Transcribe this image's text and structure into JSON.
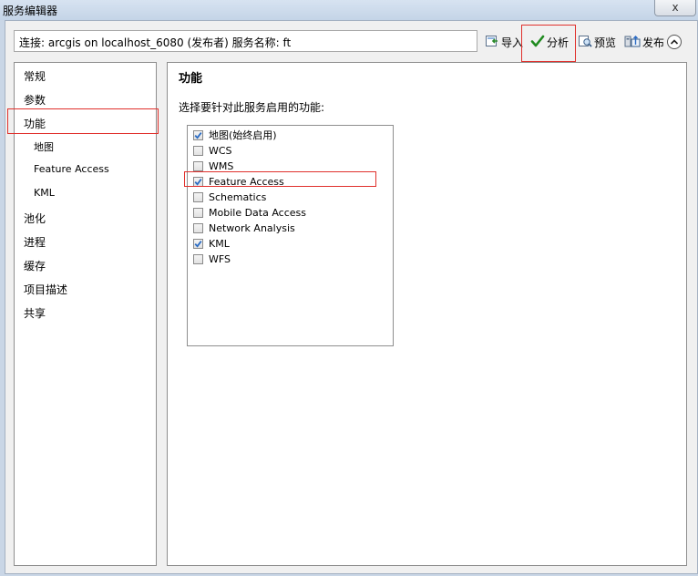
{
  "window": {
    "title": "服务编辑器",
    "close_glyph": "x"
  },
  "connection": {
    "text": "连接: arcgis on localhost_6080 (发布者)    服务名称: ft"
  },
  "toolbar": {
    "import_label": "导入",
    "analyze_label": "分析",
    "preview_label": "预览",
    "publish_label": "发布"
  },
  "sidebar": {
    "items": [
      {
        "label": "常规"
      },
      {
        "label": "参数"
      },
      {
        "label": "功能"
      },
      {
        "label": "地图"
      },
      {
        "label": "Feature Access"
      },
      {
        "label": "KML"
      },
      {
        "label": "池化"
      },
      {
        "label": "进程"
      },
      {
        "label": "缓存"
      },
      {
        "label": "项目描述"
      },
      {
        "label": "共享"
      }
    ]
  },
  "main": {
    "title": "功能",
    "description": "选择要针对此服务启用的功能:",
    "capabilities": [
      {
        "label": "地图(始终启用)",
        "checked": true
      },
      {
        "label": "WCS",
        "checked": false
      },
      {
        "label": "WMS",
        "checked": false
      },
      {
        "label": "Feature Access",
        "checked": true
      },
      {
        "label": "Schematics",
        "checked": false
      },
      {
        "label": "Mobile Data Access",
        "checked": false
      },
      {
        "label": "Network Analysis",
        "checked": false
      },
      {
        "label": "KML",
        "checked": true
      },
      {
        "label": "WFS",
        "checked": false
      }
    ]
  },
  "colors": {
    "highlight": "#e0302c",
    "check": "#2b6cc4",
    "analyze_check": "#1f8a1f"
  }
}
